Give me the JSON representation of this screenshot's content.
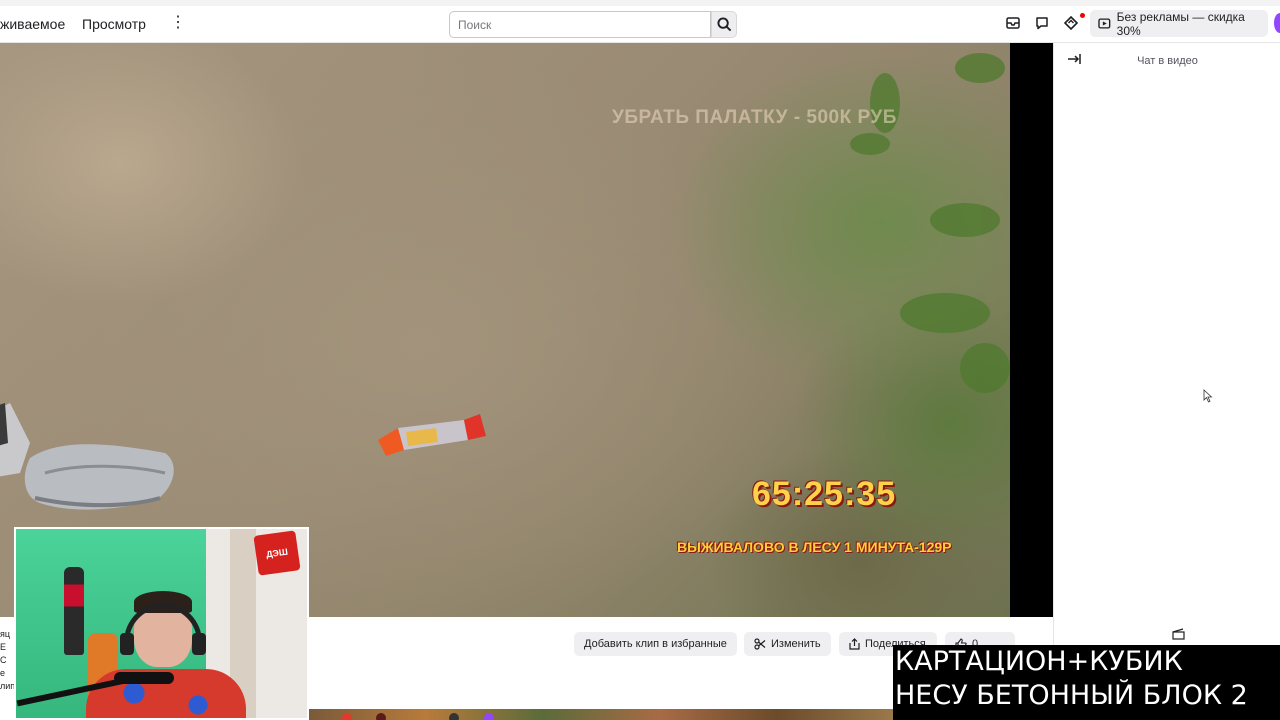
{
  "nav": {
    "following_partial": "живаемое",
    "browse": "Просмотр",
    "more_label": "⋮"
  },
  "search": {
    "placeholder": "Поиск"
  },
  "promo": {
    "label": "Без рекламы — скидка 30%"
  },
  "icons": [
    "search-icon",
    "inbox-icon",
    "whispers-icon",
    "prime-crown-icon",
    "promo-ad-icon",
    "chat-collapse-icon",
    "clip-icon",
    "scissors-icon",
    "share-icon",
    "like-icon",
    "more-icon"
  ],
  "colors": {
    "accent": "#9147ff",
    "alert_dot": "#eb0400",
    "button_bg": "#efeff1"
  },
  "video": {
    "overlay_top": "УБРАТЬ ПАЛАТКУ - 500К РУБ",
    "timer": "65:25:35",
    "overlay_bottom": "ВЫЖИВАЛОВО В ЛЕСУ 1 МИНУТА-129Р"
  },
  "chat": {
    "title": "Чат в видео"
  },
  "actions": {
    "add_clip": "Добавить клип в избранные",
    "edit": "Изменить",
    "share": "Поделиться",
    "like_count": "0"
  },
  "webcam": {
    "logo_text": "ДЭШ"
  },
  "left_cut": [
    "яц",
    "Е С",
    "е",
    "лип"
  ],
  "caption": {
    "line1": "КАРТАЦИОН+КУБИК",
    "line2": "НЕСУ БЕТОННЫЙ БЛОК 2"
  }
}
